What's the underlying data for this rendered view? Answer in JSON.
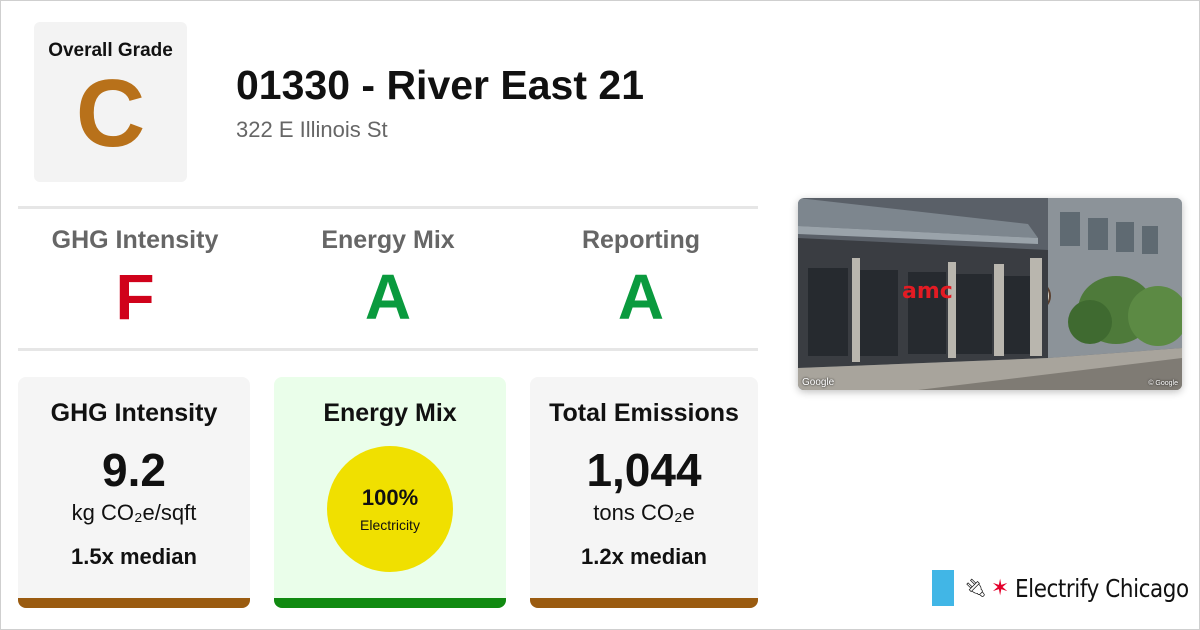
{
  "overall": {
    "label": "Overall Grade",
    "grade": "C",
    "color": "#b8711a"
  },
  "building": {
    "title": "01330 - River East 21",
    "address": "322 E Illinois St"
  },
  "grades": [
    {
      "label": "GHG Intensity",
      "grade": "F",
      "color": "#d0021b"
    },
    {
      "label": "Energy Mix",
      "grade": "A",
      "color": "#0a9a3e"
    },
    {
      "label": "Reporting",
      "grade": "A",
      "color": "#0a9a3e"
    }
  ],
  "cards": {
    "ghg": {
      "title": "GHG Intensity",
      "value": "9.2",
      "unit": "kg CO₂e/sqft",
      "median": "1.5x median",
      "bar_color": "#9a5b10"
    },
    "energy": {
      "title": "Energy Mix",
      "percent": "100%",
      "source": "Electricity",
      "circle_color": "#f0e000",
      "bg_color": "#eafeea",
      "bar_color": "#118a11"
    },
    "emissions": {
      "title": "Total Emissions",
      "value": "1,044",
      "unit": "tons CO₂e",
      "median": "1.2x median",
      "bar_color": "#9a5b10"
    }
  },
  "photo": {
    "credit": "Google",
    "credit_small": "© Google",
    "sign": "amc"
  },
  "brand": {
    "name": "Electrify Chicago",
    "flag_color": "#41b6e6",
    "star_color": "#e4002b",
    "icons": [
      "plug-icon",
      "star-icon"
    ]
  }
}
